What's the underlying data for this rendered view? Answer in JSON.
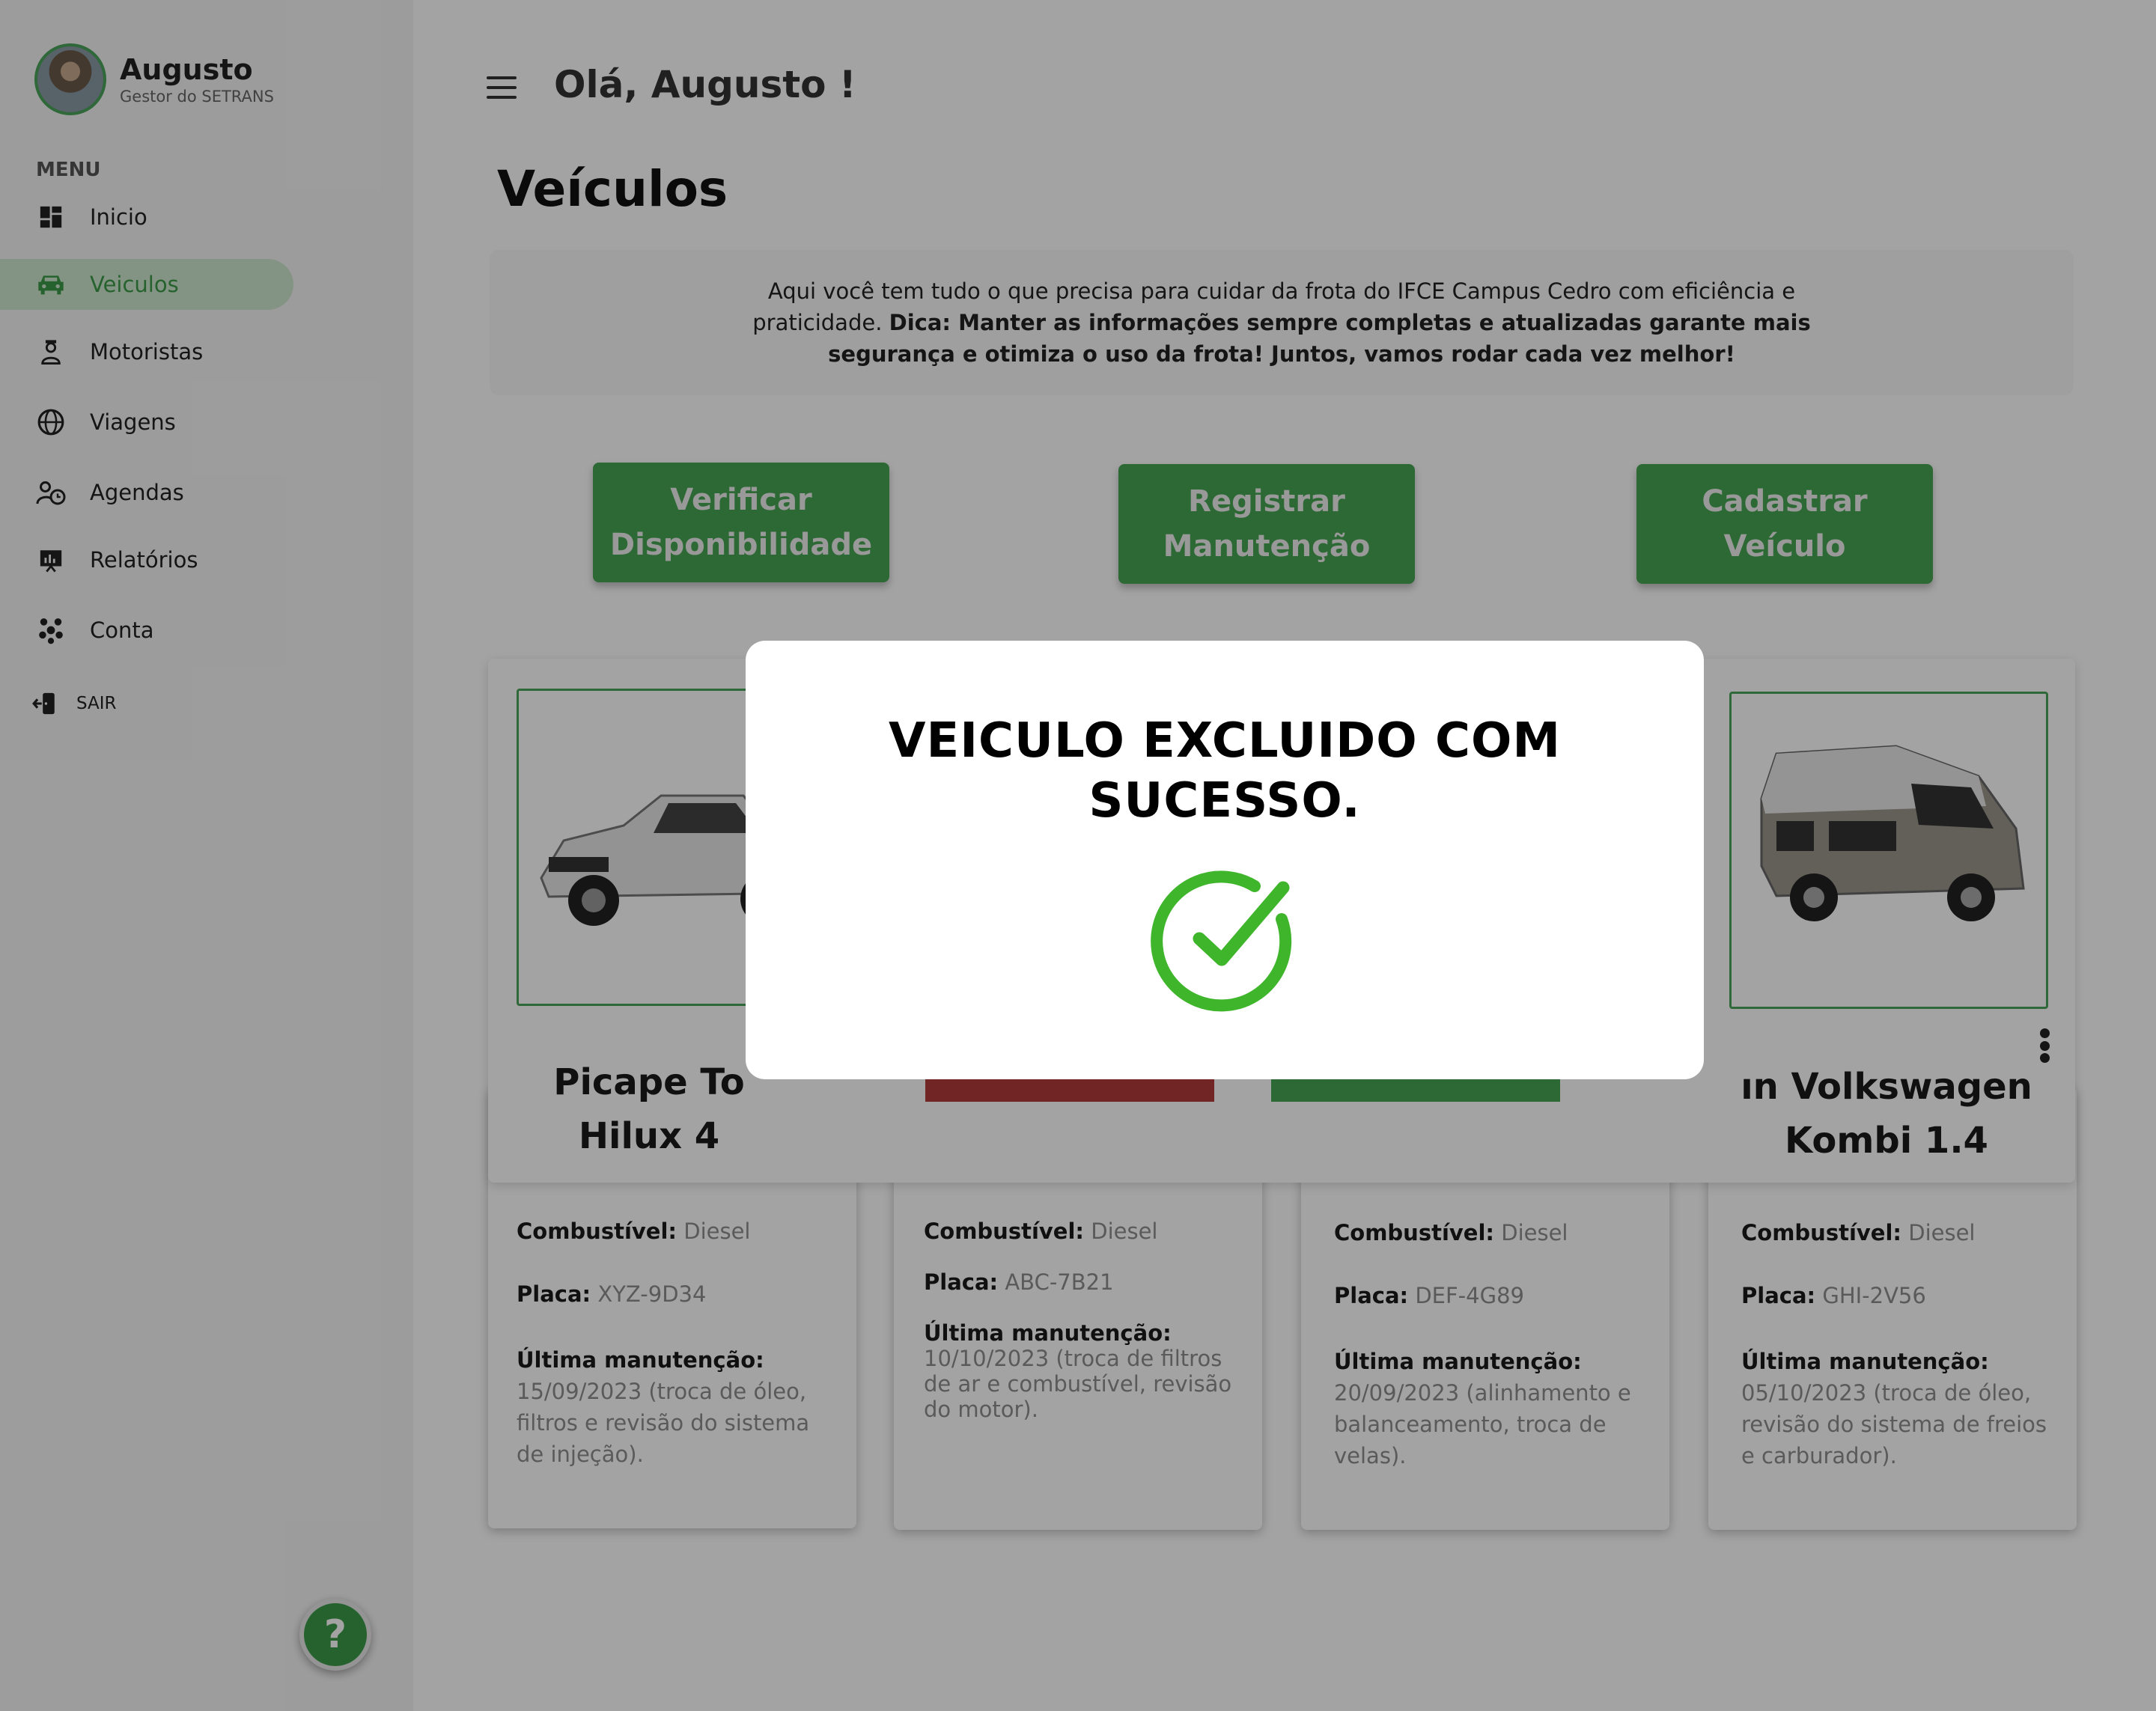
{
  "user": {
    "name": "Augusto",
    "role": "Gestor do SETRANS"
  },
  "menu": {
    "title": "MENU",
    "items": [
      {
        "label": "Inicio",
        "icon": "dashboard-icon"
      },
      {
        "label": "Veiculos",
        "icon": "car-icon",
        "active": true
      },
      {
        "label": "Motoristas",
        "icon": "driver-icon"
      },
      {
        "label": "Viagens",
        "icon": "globe-icon"
      },
      {
        "label": "Agendas",
        "icon": "schedule-icon"
      },
      {
        "label": "Relatórios",
        "icon": "report-icon"
      },
      {
        "label": "Conta",
        "icon": "account-icon"
      }
    ],
    "logout": "SAIR"
  },
  "header": {
    "greeting": "Olá, Augusto !"
  },
  "page": {
    "title": "Veículos",
    "info_plain": "Aqui você tem tudo o que precisa para cuidar da frota do IFCE Campus Cedro com eficiência e praticidade. ",
    "info_bold": "Dica: Manter as informações sempre completas e atualizadas garante mais segurança e otimiza o uso da frota! Juntos, vamos rodar cada vez melhor!"
  },
  "actions": {
    "verify": "Verificar Disponibilidade",
    "maintenance": "Registrar Manutenção",
    "register": "Cadastrar Veículo"
  },
  "labels": {
    "fuel": "Combustível:",
    "plate": "Placa:",
    "last_maintenance": "Última manutenção:"
  },
  "vehicles": [
    {
      "title": "Picape To Hilux 4",
      "fuel": "Diesel",
      "plate": "XYZ-9D34",
      "maintenance": "15/09/2023 (troca de óleo, filtros e revisão do sistema de injeção)."
    },
    {
      "title": "",
      "fuel": "Diesel",
      "plate": "ABC-7B21",
      "maintenance": "10/10/2023 (troca de filtros de ar e combustível, revisão do motor)."
    },
    {
      "title": "",
      "fuel": "Diesel",
      "plate": "DEF-4G89",
      "maintenance": "20/09/2023 (alinhamento e balanceamento, troca de velas)."
    },
    {
      "title": "ın Volkswagen Kombi 1.4",
      "fuel": "Diesel",
      "plate": "GHI-2V56",
      "maintenance": "05/10/2023 (troca de óleo, revisão do sistema de freios e carburador)."
    }
  ],
  "modal": {
    "message": "VEICULO EXCLUIDO COM SUCESSO."
  },
  "help": {
    "label": "?"
  },
  "colors": {
    "accent": "#45a552",
    "danger": "#b23a3a",
    "success_check": "#3fb52b"
  }
}
